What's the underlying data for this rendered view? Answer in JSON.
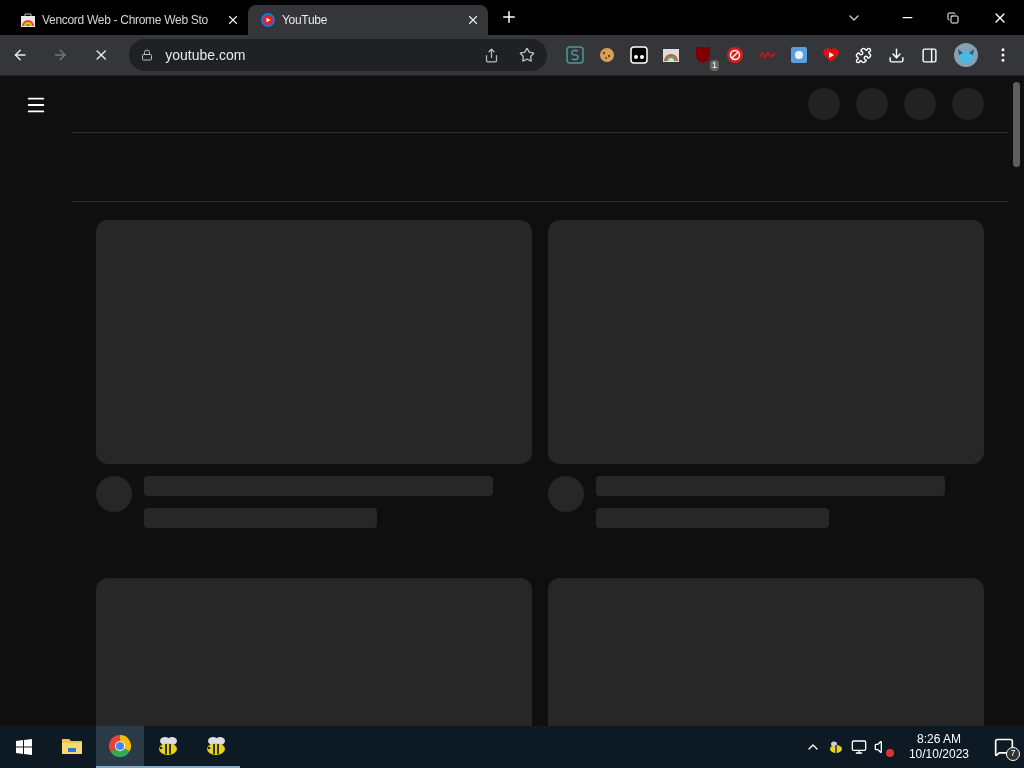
{
  "tabs": [
    {
      "title": "Vencord Web - Chrome Web Sto",
      "kind": "store",
      "selected": false
    },
    {
      "title": "YouTube",
      "kind": "youtube",
      "selected": true
    }
  ],
  "toolbar": {
    "loading": true,
    "address": "youtube.com",
    "extension_badge": "1"
  },
  "taskbar": {
    "apps": [
      {
        "kind": "explorer",
        "selected": false,
        "running": false
      },
      {
        "kind": "chrome",
        "selected": true,
        "running": true
      },
      {
        "kind": "bee",
        "selected": false,
        "running": true
      },
      {
        "kind": "bee",
        "selected": false,
        "running": true
      }
    ],
    "time": "8:26 AM",
    "date": "10/10/2023",
    "notifications": "7"
  }
}
